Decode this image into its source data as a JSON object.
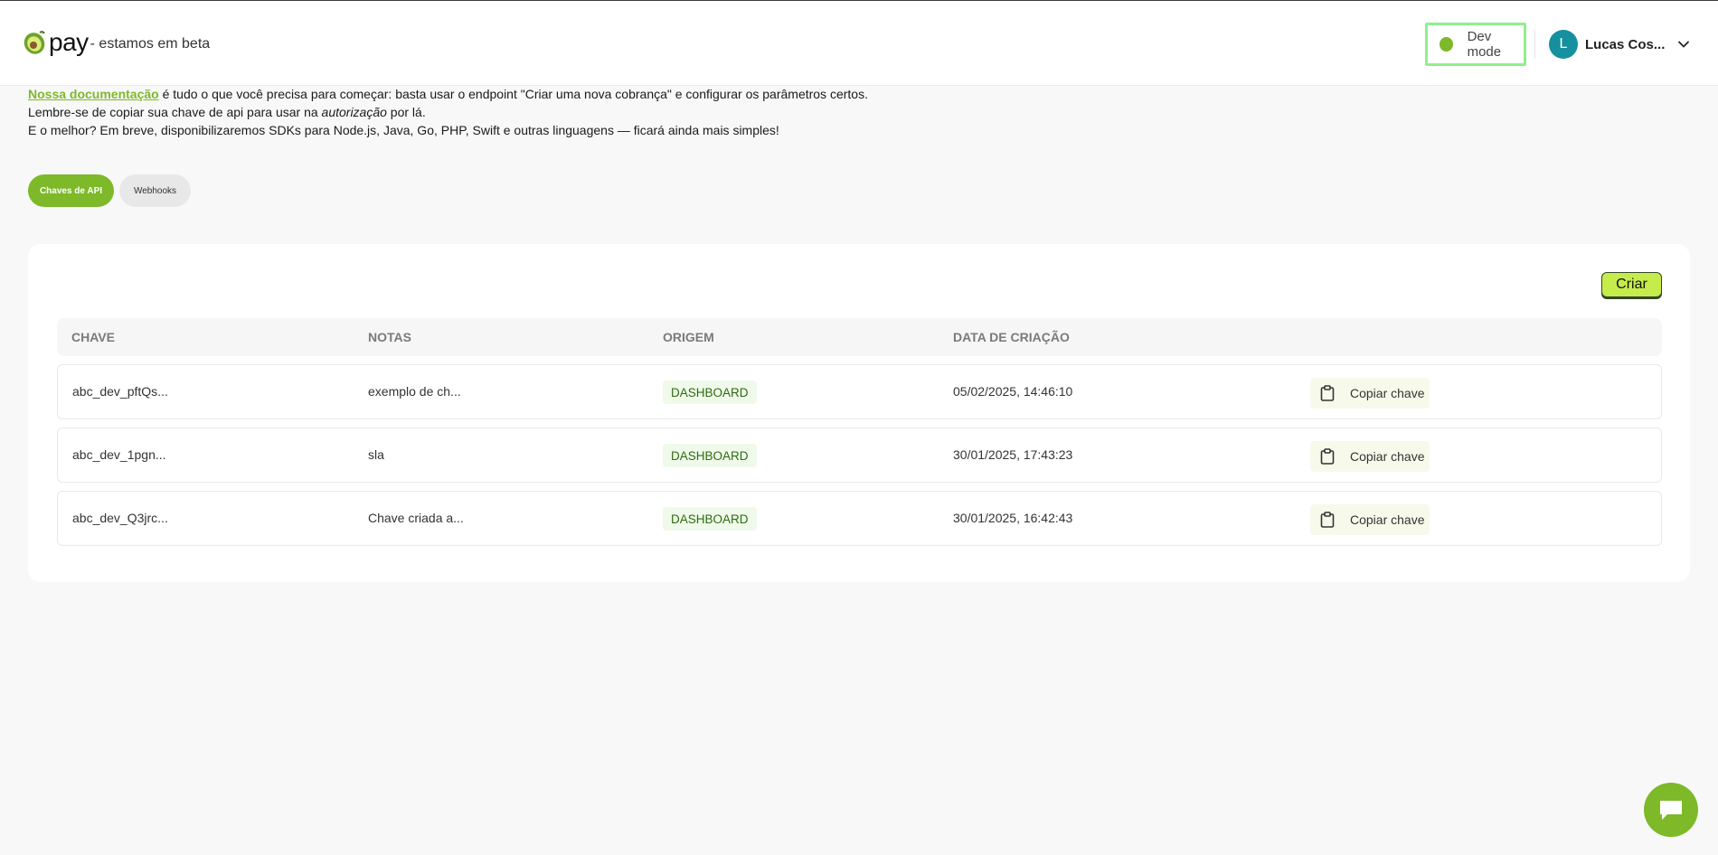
{
  "brand": {
    "name": "pay",
    "tagline": "- estamos em beta"
  },
  "header": {
    "dev_mode_label": "Dev mode",
    "user_initial": "L",
    "user_name": "Lucas Cos..."
  },
  "intro": {
    "doc_link": "Nossa documentação",
    "line1_rest": " é tudo o que você precisa para começar: basta usar o endpoint \"Criar uma nova cobrança\" e configurar os parâmetros certos.",
    "line2_before": "Lembre-se de copiar sua chave de api para usar na ",
    "line2_em": "autorização",
    "line2_after": " por lá.",
    "line3": "E o melhor? Em breve, disponibilizaremos SDKs para Node.js, Java, Go, PHP, Swift e outras linguagens — ficará ainda mais simples!"
  },
  "tabs": [
    {
      "label": "Chaves de API",
      "active": true
    },
    {
      "label": "Webhooks",
      "active": false
    }
  ],
  "create_label": "Criar",
  "table": {
    "columns": [
      "CHAVE",
      "NOTAS",
      "ORIGEM",
      "DATA DE CRIAÇÃO"
    ],
    "copy_label": "Copiar chave",
    "rows": [
      {
        "key": "abc_dev_pftQs...",
        "notes": "exemplo de ch...",
        "origin": "DASHBOARD",
        "created": "05/02/2025, 14:46:10"
      },
      {
        "key": "abc_dev_1pgn...",
        "notes": "sla",
        "origin": "DASHBOARD",
        "created": "30/01/2025, 17:43:23"
      },
      {
        "key": "abc_dev_Q3jrc...",
        "notes": "Chave criada a...",
        "origin": "DASHBOARD",
        "created": "30/01/2025, 16:42:43"
      }
    ]
  },
  "colors": {
    "accent": "#7db928",
    "create_button": "#c6ec4c",
    "dev_mode_highlight": "#8ef08e",
    "avatar": "#16909e"
  },
  "icons": {
    "logo": "avocado-icon",
    "user_menu": "chevron-down-icon",
    "copy": "clipboard-icon",
    "chat": "chat-bubble-icon"
  }
}
